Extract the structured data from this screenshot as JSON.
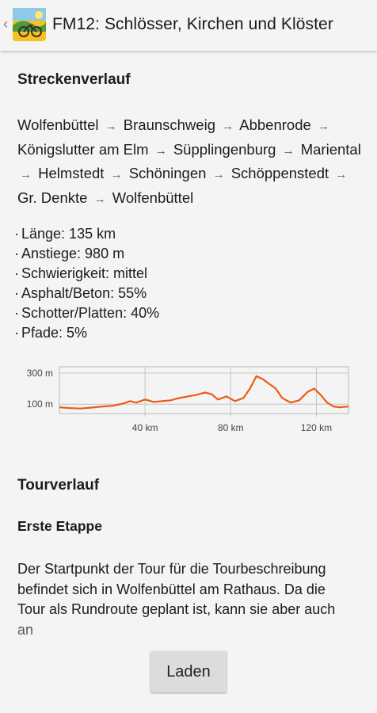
{
  "actionbar": {
    "title": "FM12: Schlösser, Kirchen und Klöster"
  },
  "route_section": {
    "heading": "Streckenverlauf",
    "stops": [
      "Wolfenbüttel",
      "Braunschweig",
      "Abbenrode",
      "Königslutter am Elm",
      "Süpplingenburg",
      "Mariental",
      "Helmstedt",
      "Schöningen",
      "Schöppenstedt",
      "Gr. Denkte",
      "Wolfenbüttel"
    ],
    "arrow": "→",
    "stats": [
      "Länge: 135 km",
      "Anstiege: 980 m",
      "Schwierigkeit: mittel",
      "Asphalt/Beton: 55%",
      "Schotter/Platten: 40%",
      "Pfade: 5%"
    ]
  },
  "chart_data": {
    "type": "line",
    "x_unit": "km",
    "y_unit": "m",
    "xlim": [
      0,
      135
    ],
    "ylim": [
      40,
      340
    ],
    "x_ticks": [
      40,
      80,
      120
    ],
    "x_tick_labels": [
      "40 km",
      "80 km",
      "120 km"
    ],
    "y_ticks": [
      100,
      300
    ],
    "y_tick_labels": [
      "300 m",
      "100 m"
    ],
    "grid": true,
    "line_color": "#ee5a12",
    "x": [
      0,
      5,
      10,
      15,
      20,
      25,
      30,
      33,
      36,
      40,
      44,
      48,
      52,
      56,
      60,
      64,
      68,
      71,
      74,
      78,
      82,
      86,
      89,
      92,
      95,
      98,
      101,
      104,
      108,
      112,
      116,
      119,
      122,
      125,
      128,
      131,
      135
    ],
    "values": [
      80,
      75,
      72,
      78,
      85,
      90,
      105,
      120,
      110,
      130,
      115,
      120,
      125,
      140,
      150,
      160,
      175,
      165,
      130,
      150,
      120,
      140,
      200,
      280,
      260,
      230,
      200,
      140,
      110,
      125,
      180,
      200,
      160,
      110,
      85,
      80,
      85
    ]
  },
  "tour_section": {
    "heading": "Tourverlauf",
    "subheading": "Erste Etappe",
    "paragraph": "Der Startpunkt der Tour für die Tourbeschreibung befindet sich in Wolfenbüttel am Rathaus. Da die Tour als Rundroute geplant ist, kann sie aber auch an"
  },
  "load_button": {
    "label": "Laden"
  }
}
